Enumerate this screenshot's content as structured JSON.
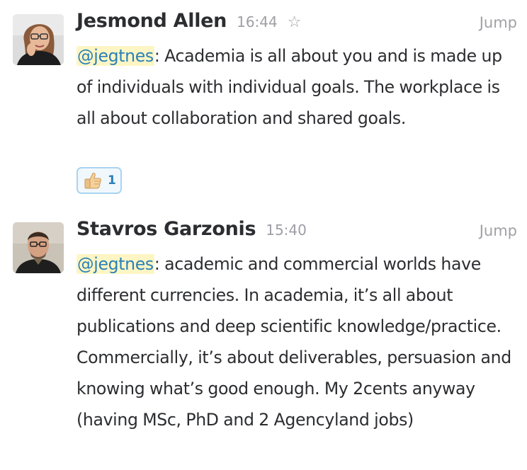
{
  "messages": [
    {
      "sender": "Jesmond Allen",
      "time": "16:44",
      "jump_label": "Jump",
      "mention": "@jegtnes",
      "text": ": Academia is all about you and is made up of individuals with individual goals. The workplace is all about collaboration and shared goals.",
      "reaction": {
        "emoji": "thumbs-up",
        "count": "1"
      }
    },
    {
      "sender": "Stavros Garzonis",
      "time": "15:40",
      "jump_label": "Jump",
      "mention": "@jegtnes",
      "text": ": academic and commercial worlds have different currencies. In academia, it’s all about publications and deep scientific knowledge/practice. Commercially, it’s about deliverables, persuasion  and knowing what’s good enough. My 2cents anyway (having MSc, PhD and 2 Agencyland jobs)"
    }
  ],
  "icons": {
    "star": "star-outline-icon",
    "reaction": "thumbs-up-icon"
  },
  "colors": {
    "mention_text": "#2a80b9",
    "mention_background": "#fdf6c4",
    "reaction_border": "#a9d4f1",
    "reaction_background": "#f1f8fd",
    "muted_text": "#9e9ea6"
  }
}
